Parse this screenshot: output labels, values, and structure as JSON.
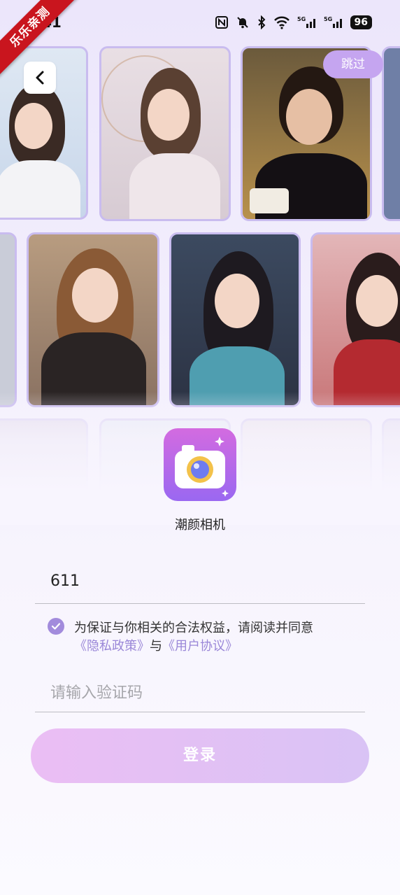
{
  "watermark": "乐乐亲测",
  "status_bar": {
    "time": "41",
    "battery": "96",
    "network": "5G"
  },
  "header": {
    "skip_label": "跳过"
  },
  "app": {
    "name": "潮颜相机"
  },
  "form": {
    "phone_value": "611",
    "agreement_text": "为保证与你相关的合法权益，请阅读并同意",
    "privacy_link": "《隐私政策》",
    "conjunction": "与",
    "terms_link": "《用户协议》",
    "code_placeholder": "请输入验证码",
    "login_label": "登录"
  },
  "colors": {
    "accent": "#a28bdc",
    "link": "#9a87d8",
    "card_border": "#c9bcef",
    "skip_bg": "#c5a5f0"
  },
  "gallery": {
    "rows": 3,
    "visible_cards": 13
  }
}
